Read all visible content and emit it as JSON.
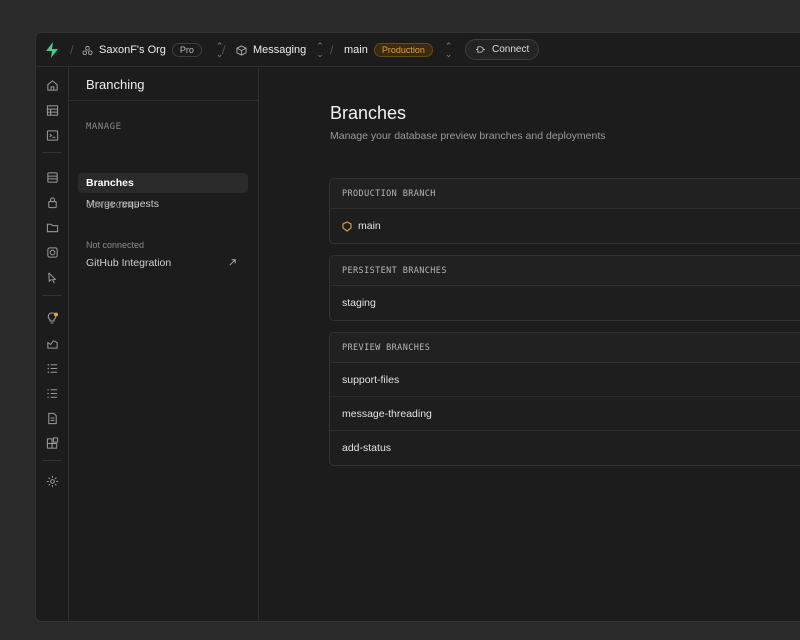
{
  "topbar": {
    "org_name": "SaxonF's Org",
    "plan_badge": "Pro",
    "project_name": "Messaging",
    "branch_name": "main",
    "env_badge": "Production",
    "connect_label": "Connect"
  },
  "sidemenu": {
    "title": "Branching",
    "sections": [
      {
        "label": "MANAGE",
        "items": [
          "Branches",
          "Merge requests"
        ]
      },
      {
        "label": "CONFIGURE",
        "items": [
          "GitHub Integration"
        ]
      }
    ],
    "github_status": "Not connected"
  },
  "main": {
    "title": "Branches",
    "subtitle": "Manage your database preview branches and deployments",
    "groups": [
      {
        "header": "PRODUCTION BRANCH",
        "branches": [
          "main"
        ]
      },
      {
        "header": "PERSISTENT BRANCHES",
        "branches": [
          "staging"
        ]
      },
      {
        "header": "PREVIEW BRANCHES",
        "branches": [
          "support-files",
          "message-threading",
          "add-status"
        ]
      }
    ]
  },
  "colors": {
    "accent_green": "#3ecf8e",
    "production_amber": "#e7a13a",
    "background": "#1c1c1c"
  },
  "icons": [
    "home-icon",
    "table-editor-icon",
    "sql-editor-icon",
    "database-icon",
    "auth-icon",
    "storage-icon",
    "edge-functions-icon",
    "realtime-icon",
    "advisors-icon",
    "reports-icon",
    "logs-icon",
    "api-docs-icon",
    "docs-icon",
    "integrations-icon",
    "settings-icon"
  ]
}
